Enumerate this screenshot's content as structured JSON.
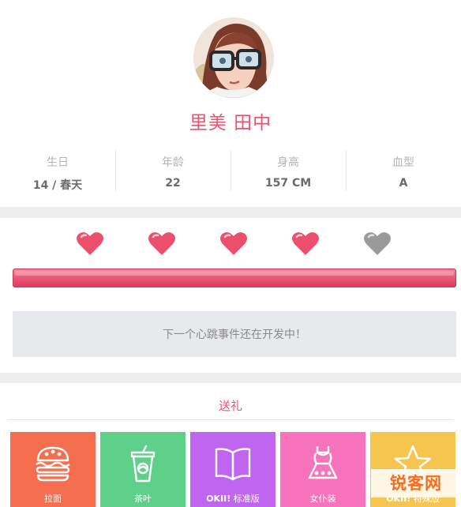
{
  "profile": {
    "avatar_name": "character-portrait",
    "name": "里美 田中",
    "stats": [
      {
        "label": "生日",
        "value": "14 / 春天"
      },
      {
        "label": "年龄",
        "value": "22"
      },
      {
        "label": "身高",
        "value": "157 CM"
      },
      {
        "label": "血型",
        "value": "A"
      }
    ]
  },
  "affection": {
    "hearts_filled": 4,
    "hearts_total": 5,
    "progress": 1.0,
    "notice": "下一个心跳事件还在开发中！"
  },
  "gift": {
    "title": "送礼",
    "items": [
      {
        "label": "拉面",
        "label_bold": "",
        "icon": "burger-icon",
        "color": "#f56e4d"
      },
      {
        "label": "茶叶",
        "label_bold": "",
        "icon": "tea-cup-icon",
        "color": "#5fd08a"
      },
      {
        "label": "标准版",
        "label_bold": "OKII!",
        "icon": "book-icon",
        "color": "#c065f0"
      },
      {
        "label": "女仆装",
        "label_bold": "",
        "icon": "dress-icon",
        "color": "#f774bc"
      },
      {
        "label": "特殊版",
        "label_bold": "OKII!",
        "icon": "star-icon",
        "color": "#f6c54f"
      }
    ]
  },
  "colors": {
    "accent": "#e8546e",
    "heart": "#ec4f6c",
    "heart_empty": "#9a9a9a"
  },
  "watermark": "锐客网"
}
